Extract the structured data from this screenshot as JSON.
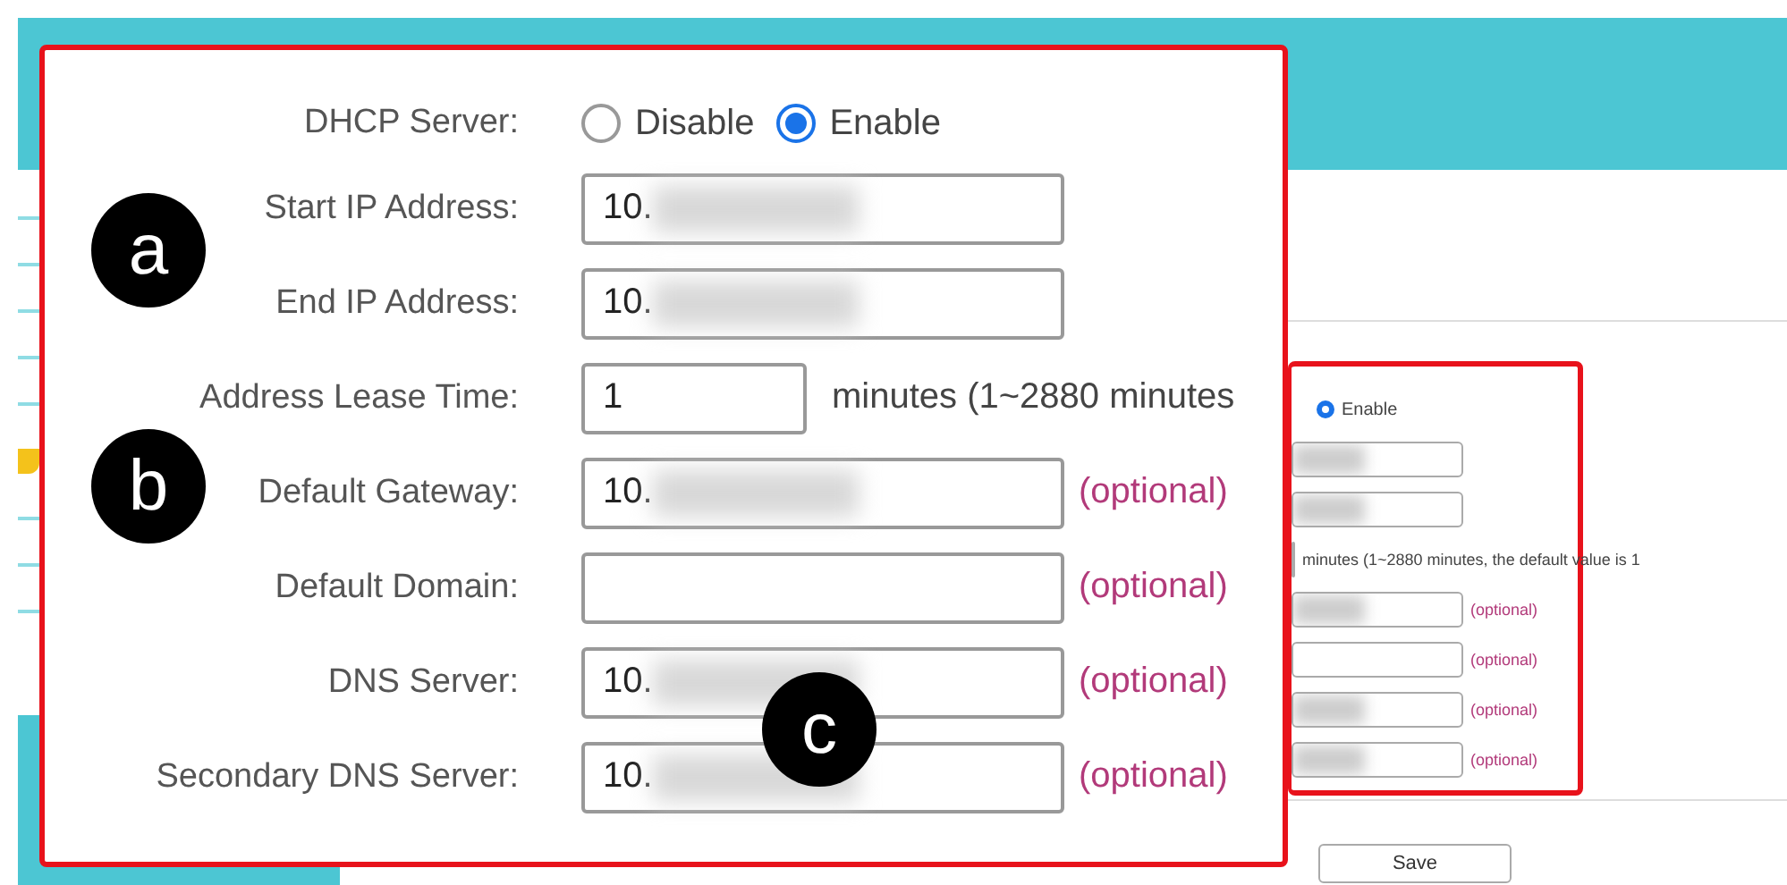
{
  "background_form": {
    "radio_options": [
      {
        "label": "Enable",
        "selected": true
      }
    ],
    "rows": [
      {
        "kind": "field",
        "blurred": true
      },
      {
        "kind": "field",
        "blurred": true
      },
      {
        "kind": "lease",
        "note": "minutes (1~2880 minutes, the default value is 1"
      },
      {
        "kind": "optional",
        "blurred": true,
        "note": "(optional)"
      },
      {
        "kind": "optional",
        "blurred": false,
        "note": "(optional)"
      },
      {
        "kind": "optional",
        "blurred": true,
        "note": "(optional)"
      },
      {
        "kind": "optional",
        "blurred": true,
        "note": "(optional)"
      }
    ],
    "save_button": "Save"
  },
  "zoomed_form": {
    "dhcp_server": {
      "label": "DHCP Server:",
      "options": [
        {
          "label": "Disable",
          "selected": false
        },
        {
          "label": "Enable",
          "selected": true
        }
      ]
    },
    "fields": [
      {
        "kind": "field",
        "label": "Start IP Address:",
        "value": "10.",
        "blurred": true
      },
      {
        "kind": "field",
        "label": "End IP Address:",
        "value": "10.",
        "blurred": true
      },
      {
        "kind": "lease",
        "label": "Address Lease Time:",
        "value": "1",
        "note": "minutes (1~2880 minutes"
      },
      {
        "kind": "optional",
        "label": "Default Gateway:",
        "value": "10.",
        "blurred": true,
        "note": "(optional)"
      },
      {
        "kind": "optional",
        "label": "Default Domain:",
        "blurred": false,
        "note": "(optional)"
      },
      {
        "kind": "optional",
        "label": "DNS Server:",
        "value": "10.",
        "blurred": true,
        "note": "(optional)"
      },
      {
        "kind": "optional",
        "label": "Secondary DNS Server:",
        "value": "10.",
        "blurred": true,
        "note": "(optional)"
      }
    ]
  },
  "callouts": [
    "a",
    "b",
    "c"
  ]
}
